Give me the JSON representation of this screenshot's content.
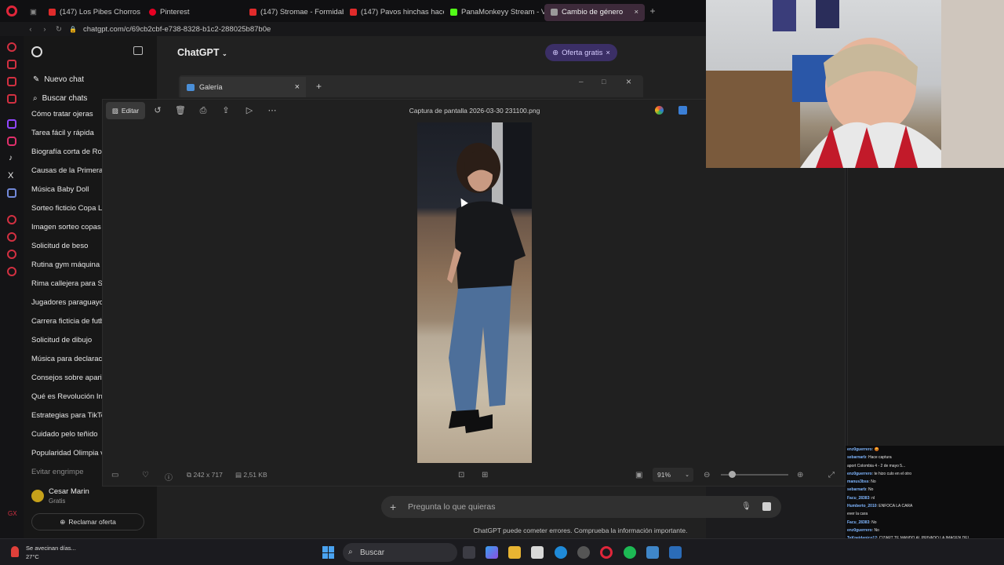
{
  "browser": {
    "tabs": [
      {
        "label": "(147) Los Pibes Chorros -",
        "icon": "youtube-icon",
        "color": "#e02b2b"
      },
      {
        "label": "Pinterest",
        "icon": "pinterest-icon",
        "color": "#e60023"
      },
      {
        "label": "(147) Stromae - Formidab",
        "icon": "youtube-icon",
        "color": "#e02b2b"
      },
      {
        "label": "(147) Pavos hinchas hace",
        "icon": "youtube-icon",
        "color": "#e02b2b"
      },
      {
        "label": "PanaMonkeyy Stream - Vi",
        "icon": "kick-icon",
        "color": "#53fc18"
      },
      {
        "label": "Cambio de género",
        "icon": "chatgpt-icon",
        "color": "#9a9a9a"
      }
    ],
    "url": "chatgpt.com/c/69cb2cbf-e738-8328-b1c2-288025b87b0e"
  },
  "sidebar": {
    "new_chat": "Nuevo chat",
    "search_chats": "Buscar chats",
    "items": [
      "Cómo tratar ojeras",
      "Tarea fácil y rápida",
      "Biografía corta de Roa",
      "Causas de la Primera",
      "Música Baby Doll",
      "Sorteo ficticio Copa Li",
      "Imagen sorteo copas",
      "Solicitud de beso",
      "Rutina gym máquina",
      "Rima callejera para Sc",
      "Jugadores paraguayo",
      "Carrera ficticia de futb",
      "Solicitud de dibujo",
      "Música para declaraci",
      "Consejos sobre aparie",
      "Qué es Revolución Inc",
      "Estrategias para TikTo",
      "Cuidado pelo teñido",
      "Popularidad Olimpia v",
      "Evitar engrimpe"
    ],
    "user_name": "Cesar Marin",
    "user_plan": "Gratis",
    "claim_offer": "Reclamar oferta"
  },
  "main": {
    "title": "ChatGPT",
    "offer": "Oferta gratis",
    "composer_placeholder": "Pregunta lo que quieras",
    "disclaimer": "ChatGPT puede cometer errores. Comprueba la información importante."
  },
  "gallery": {
    "tab_title": "Galería",
    "edit_label": "Editar",
    "file_name": "Captura de pantalla 2026-03-30 231100.png",
    "dimensions": "242 x 717",
    "file_size": "2,51 KB",
    "zoom": "91%"
  },
  "taskbar": {
    "weather_desc": "Se avecinan días...",
    "weather_temp": "27°C",
    "search": "Buscar"
  },
  "twitch_chat": [
    {
      "user": "enz0guerrero",
      "text": ": 😡"
    },
    {
      "user": "sebarnarb",
      "text": ": Hace captura"
    },
    {
      "user": "",
      "text": "aport Colombia 4 - 2 de mayo 5..."
    },
    {
      "user": "enz0guerrero",
      "text": ": te hizo culo en el otro"
    },
    {
      "user": "manus3bss",
      "text": ": No"
    },
    {
      "user": "sebarnarb",
      "text": ": No"
    },
    {
      "user": "Facu_28383",
      "text": ": nl"
    },
    {
      "user": "Humberto_2010",
      "text": ": ENFOCA LA CARA"
    },
    {
      "user": "",
      "text": "ever la cara"
    },
    {
      "user": "Facu_28383",
      "text": ": No"
    },
    {
      "user": "enz0guerrero",
      "text": ": No"
    },
    {
      "user": "TeKpeidenico12",
      "text": ": CIZART TE MANDO AL PRIVADO LA IMAGEN DEL"
    },
    {
      "user": "",
      "text": "HINCHA EN WHATSAPP"
    },
    {
      "user": "nlr1912",
      "text": ": mira esto cizart"
    },
    {
      "user": "",
      "text": ": hola"
    }
  ]
}
